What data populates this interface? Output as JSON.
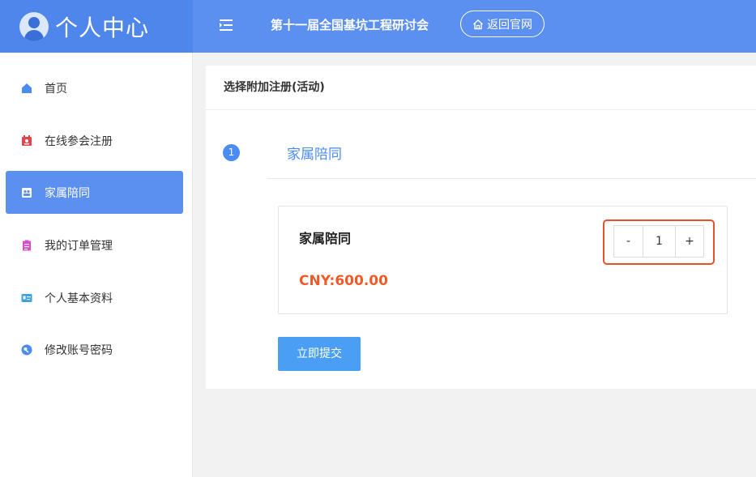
{
  "brand": {
    "title": "个人中心"
  },
  "header": {
    "conference_title": "第十一届全国基坑工程研讨会",
    "home_button": "返回官网"
  },
  "sidebar": {
    "items": [
      {
        "label": "首页",
        "icon": "home-icon",
        "color": "#4a8cf3"
      },
      {
        "label": "在线参会注册",
        "icon": "calendar-icon",
        "color": "#e8434b"
      },
      {
        "label": "家属陪同",
        "icon": "family-icon",
        "color": "#ffffff",
        "active": true
      },
      {
        "label": "我的订单管理",
        "icon": "clipboard-icon",
        "color": "#d94ad0"
      },
      {
        "label": "个人基本资料",
        "icon": "id-card-icon",
        "color": "#3aa0e8"
      },
      {
        "label": "修改账号密码",
        "icon": "key-icon",
        "color": "#4a8cf3"
      }
    ]
  },
  "main": {
    "panel_title": "选择附加注册(活动)",
    "step": {
      "number": "1",
      "label": "家属陪同"
    },
    "item": {
      "title": "家属陪同",
      "price": "CNY:600.00",
      "quantity": "1",
      "minus": "-",
      "plus": "+"
    },
    "submit_label": "立即提交"
  },
  "colors": {
    "accent": "#5b8ff0",
    "price": "#f05a28",
    "highlight": "#e8522b"
  }
}
